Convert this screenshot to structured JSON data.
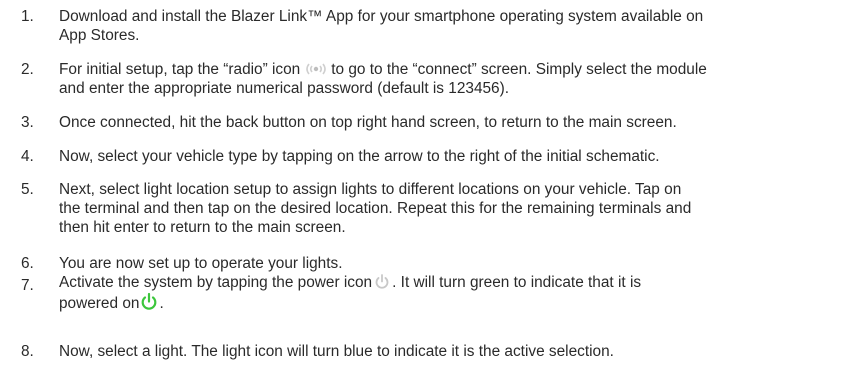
{
  "steps": [
    {
      "num": "1.",
      "lines": [
        "Download and install the Blazer Link™ App for your smartphone operating system available on",
        "App Stores."
      ]
    },
    {
      "num": "2.",
      "l1a": "For initial setup, tap the “radio” icon",
      "l1b": "to go to the “connect” screen. Simply select the module",
      "l2": "and enter the appropriate numerical password (default is 123456)."
    },
    {
      "num": "3.",
      "lines": [
        "Once connected, hit the back button on top right hand screen, to return to the main screen."
      ]
    },
    {
      "num": "4.",
      "lines": [
        "Now, select your vehicle type by tapping on the arrow to the right of the initial  schematic."
      ]
    },
    {
      "num": "5.",
      "lines": [
        "Next, select light location setup to assign lights to different locations on your vehicle. Tap on",
        "the terminal and then tap on the desired location. Repeat this for the remaining terminals and",
        "then hit enter to return to the main screen."
      ]
    },
    {
      "num": "6.",
      "lines": [
        "You are now set up to operate your lights."
      ]
    },
    {
      "num": "7.",
      "l1a": "Activate the system by tapping the power icon",
      "l1b": ". It will turn green to indicate that it is",
      "l2": "powered on",
      "l2b": "."
    },
    {
      "num": "8.",
      "lines": [
        "Now, select a light. The light icon will turn blue to indicate it is the active selection."
      ]
    }
  ],
  "icons": {
    "radio": "radio-icon",
    "power_gray": "power-icon",
    "power_green": "power-icon",
    "gray_color": "#c8c8c8",
    "green_color": "#3cc63c"
  }
}
